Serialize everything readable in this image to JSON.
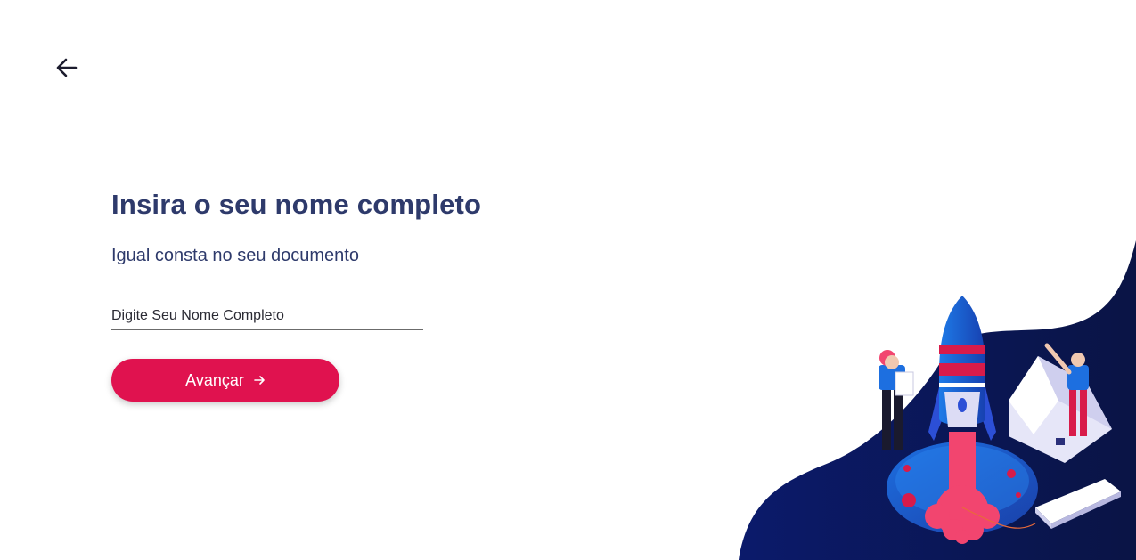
{
  "header": {
    "back_icon": "arrow-left-icon"
  },
  "form": {
    "title": "Insira o seu nome completo",
    "subtitle": "Igual consta no seu documento",
    "name_field": {
      "value": "",
      "placeholder": "Digite Seu Nome Completo"
    },
    "submit_label": "Avançar",
    "submit_icon": "arrow-right-icon"
  },
  "illustration": {
    "icon": "rocket-launch-illustration"
  },
  "colors": {
    "primary": "#e0124f",
    "heading": "#2e3a6b",
    "navy": "#0d1a5c"
  }
}
